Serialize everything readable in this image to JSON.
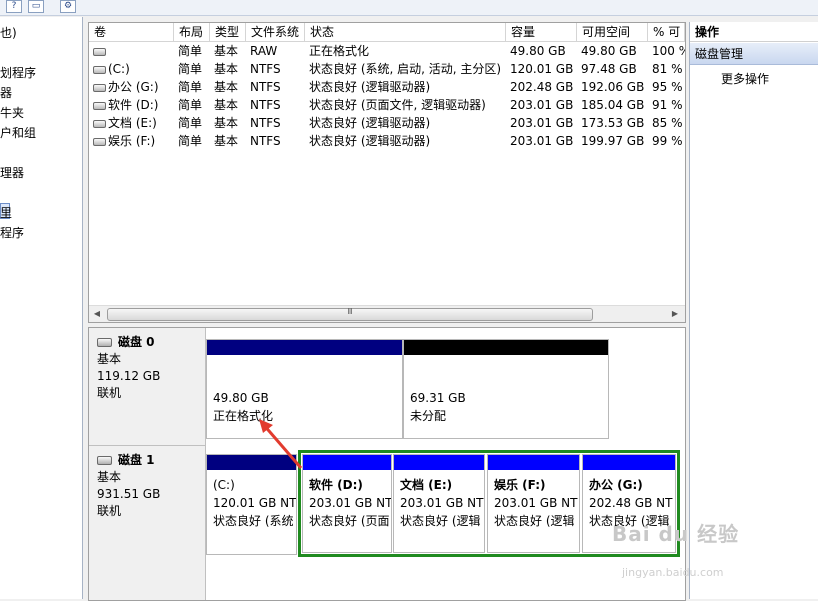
{
  "toolbar": {
    "icons": [
      "help-icon",
      "properties-icon",
      "gear-icon"
    ]
  },
  "tree": {
    "items": [
      {
        "label": "也)"
      },
      {
        "label": "划程序"
      },
      {
        "label": "器"
      },
      {
        "label": "牛夹"
      },
      {
        "label": "户和组"
      },
      {
        "label": "理器"
      },
      {
        "label": "里"
      },
      {
        "label": "程序"
      }
    ]
  },
  "volume_list": {
    "columns": [
      "卷",
      "布局",
      "类型",
      "文件系统",
      "状态",
      "容量",
      "可用空间",
      "% 可"
    ],
    "rows": [
      {
        "volume": "",
        "layout": "简单",
        "type": "基本",
        "fs": "RAW",
        "status": "正在格式化",
        "capacity": "49.80 GB",
        "free": "49.80 GB",
        "pct": "100 %"
      },
      {
        "volume": "(C:)",
        "layout": "简单",
        "type": "基本",
        "fs": "NTFS",
        "status": "状态良好 (系统, 启动, 活动, 主分区)",
        "capacity": "120.01 GB",
        "free": "97.48 GB",
        "pct": "81 %"
      },
      {
        "volume": "办公 (G:)",
        "layout": "简单",
        "type": "基本",
        "fs": "NTFS",
        "status": "状态良好 (逻辑驱动器)",
        "capacity": "202.48 GB",
        "free": "192.06 GB",
        "pct": "95 %"
      },
      {
        "volume": "软件 (D:)",
        "layout": "简单",
        "type": "基本",
        "fs": "NTFS",
        "status": "状态良好 (页面文件, 逻辑驱动器)",
        "capacity": "203.01 GB",
        "free": "185.04 GB",
        "pct": "91 %"
      },
      {
        "volume": "文档 (E:)",
        "layout": "简单",
        "type": "基本",
        "fs": "NTFS",
        "status": "状态良好 (逻辑驱动器)",
        "capacity": "203.01 GB",
        "free": "173.53 GB",
        "pct": "85 %"
      },
      {
        "volume": "娱乐 (F:)",
        "layout": "简单",
        "type": "基本",
        "fs": "NTFS",
        "status": "状态良好 (逻辑驱动器)",
        "capacity": "203.01 GB",
        "free": "199.97 GB",
        "pct": "99 %"
      }
    ],
    "scroll_grip": "Ⅲ"
  },
  "disks": [
    {
      "name": "磁盘 0",
      "kind": "基本",
      "size": "119.12 GB",
      "state": "联机",
      "partitions": [
        {
          "name": "",
          "size": "49.80 GB",
          "status": "正在格式化",
          "bar_color": "#000080"
        },
        {
          "name": "",
          "size": "69.31 GB",
          "status": "未分配",
          "bar_color": "#000000"
        }
      ]
    },
    {
      "name": "磁盘 1",
      "kind": "基本",
      "size": "931.51 GB",
      "state": "联机",
      "partitions": [
        {
          "name": "(C:)",
          "size": "120.01 GB NT",
          "status": "状态良好 (系统",
          "bar_color": "#000080"
        },
        {
          "name": "软件  (D:)",
          "size": "203.01 GB NT",
          "status": "状态良好 (页面",
          "bar_color": "#0000ff"
        },
        {
          "name": "文档  (E:)",
          "size": "203.01 GB NT",
          "status": "状态良好 (逻辑",
          "bar_color": "#0000ff"
        },
        {
          "name": "娱乐  (F:)",
          "size": "203.01 GB NT",
          "status": "状态良好 (逻辑",
          "bar_color": "#0000ff"
        },
        {
          "name": "办公  (G:)",
          "size": "202.48 GB NT",
          "status": "状态良好 (逻辑",
          "bar_color": "#0000ff"
        }
      ]
    }
  ],
  "actions": {
    "header": "操作",
    "selected": "磁盘管理",
    "more": "更多操作"
  },
  "watermark": {
    "text": "Bai du 经验",
    "sub": "jingyan.baidu.com"
  },
  "colors": {
    "highlight_border": "#1f8a1f",
    "annotation_arrow": "#e23b2e"
  }
}
